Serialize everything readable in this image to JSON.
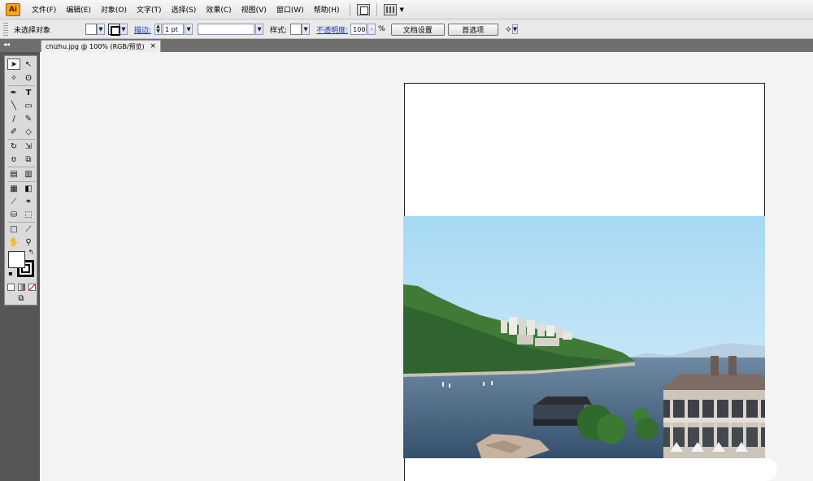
{
  "app": {
    "logo_text": "Ai"
  },
  "menu": {
    "items": [
      "文件(F)",
      "编辑(E)",
      "对象(O)",
      "文字(T)",
      "选择(S)",
      "效果(C)",
      "视图(V)",
      "窗口(W)",
      "帮助(H)"
    ],
    "icons": [
      "bridge-icon",
      "arrange-documents-icon"
    ]
  },
  "control_bar": {
    "selection_label": "未选择对象",
    "stroke_label": "描边:",
    "stroke_weight": "1 pt",
    "style_label": "样式:",
    "opacity_label": "不透明度:",
    "opacity_value": "100",
    "percent": "%",
    "doc_setup_button": "文档设置",
    "preferences_button": "首选项"
  },
  "document": {
    "tab_title": "chizhu.jpg @ 100% (RGB/预览)",
    "tab_close": "×",
    "panel_collapse": "◂◂"
  },
  "toolbox": {
    "fill_color": "#ffffff",
    "stroke_color": "#000000"
  },
  "colors": {
    "accent": "#f8a51c",
    "link": "#1c2fc4",
    "canvas": "#f3f3f3",
    "toolbar_dark": "#565656"
  }
}
